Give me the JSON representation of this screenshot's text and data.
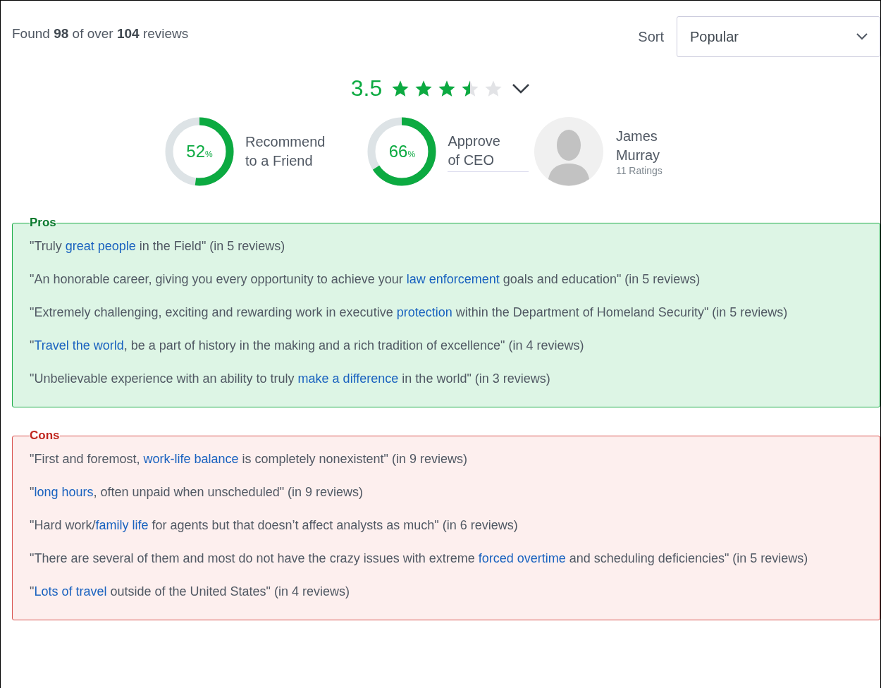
{
  "summary": {
    "parts": [
      "Found ",
      "98",
      " of over ",
      "104",
      " reviews"
    ]
  },
  "sort": {
    "label": "Sort",
    "value": "Popular"
  },
  "rating": {
    "value": "3.5",
    "stars": 3.5
  },
  "gauges": [
    {
      "value": "52",
      "unit": "%",
      "level": 0.52,
      "label_lines": [
        "Recommend",
        "to a Friend"
      ]
    },
    {
      "value": "66",
      "unit": "%",
      "level": 0.66,
      "label_lines": [
        "Approve",
        "of CEO"
      ]
    }
  ],
  "ceo": {
    "name_lines": [
      "James",
      "Murray"
    ],
    "ratings": "11 Ratings"
  },
  "sections": [
    {
      "kind": "pros",
      "title": "Pros",
      "quotes": [
        [
          {
            "kind": "text",
            "text": "\"Truly "
          },
          {
            "kind": "link",
            "text": "great people"
          },
          {
            "kind": "text",
            "text": " in the Field\" (in 5 reviews)"
          }
        ],
        [
          {
            "kind": "text",
            "text": "\"An honorable career, giving you every opportunity to achieve your "
          },
          {
            "kind": "link",
            "text": "law enforcement"
          },
          {
            "kind": "text",
            "text": " goals and education\" (in 5 reviews)"
          }
        ],
        [
          {
            "kind": "text",
            "text": "\"Extremely challenging, exciting and rewarding work in executive "
          },
          {
            "kind": "link",
            "text": "protection"
          },
          {
            "kind": "text",
            "text": " within the Department of Homeland Security\" (in 5 reviews)"
          }
        ],
        [
          {
            "kind": "text",
            "text": "\""
          },
          {
            "kind": "link",
            "text": "Travel the world"
          },
          {
            "kind": "text",
            "text": ", be a part of history in the making and a rich tradition of excellence\" (in 4 reviews)"
          }
        ],
        [
          {
            "kind": "text",
            "text": "\"Unbelievable experience with an ability to truly "
          },
          {
            "kind": "link",
            "text": "make a difference"
          },
          {
            "kind": "text",
            "text": " in the world\" (in 3 reviews)"
          }
        ]
      ]
    },
    {
      "kind": "cons",
      "title": "Cons",
      "quotes": [
        [
          {
            "kind": "text",
            "text": "\"First and foremost, "
          },
          {
            "kind": "link",
            "text": "work-life balance"
          },
          {
            "kind": "text",
            "text": " is completely nonexistent\" (in 9 reviews)"
          }
        ],
        [
          {
            "kind": "text",
            "text": "\""
          },
          {
            "kind": "link",
            "text": "long hours"
          },
          {
            "kind": "text",
            "text": ", often unpaid when unscheduled\" (in 9 reviews)"
          }
        ],
        [
          {
            "kind": "text",
            "text": "\"Hard work/"
          },
          {
            "kind": "link",
            "text": "family life"
          },
          {
            "kind": "text",
            "text": " for agents but that doesn’t affect analysts as much\" (in 6 reviews)"
          }
        ],
        [
          {
            "kind": "text",
            "text": "\"There are several of them and most do not have the crazy issues with extreme "
          },
          {
            "kind": "link",
            "text": "forced overtime"
          },
          {
            "kind": "text",
            "text": " and scheduling deficiencies\" (in 5 reviews)"
          }
        ],
        [
          {
            "kind": "text",
            "text": "\""
          },
          {
            "kind": "link",
            "text": "Lots of travel"
          },
          {
            "kind": "text",
            "text": " outside of the United States\" (in 4 reviews)"
          }
        ]
      ]
    }
  ]
}
